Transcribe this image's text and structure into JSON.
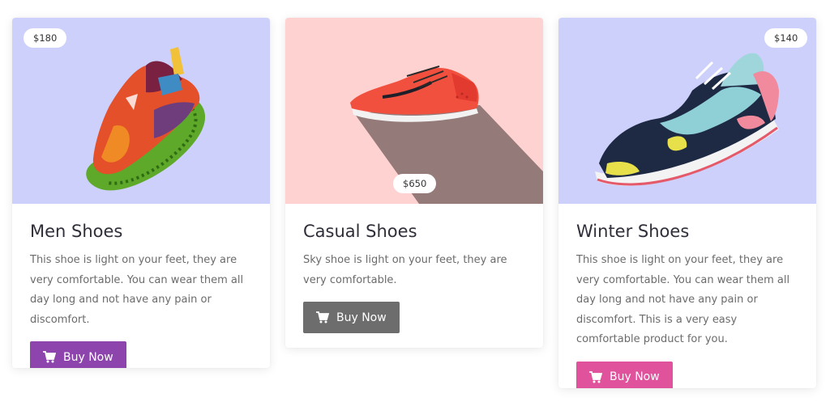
{
  "cards": [
    {
      "price": "$180",
      "title": "Men Shoes",
      "description": "This shoe is light on your feet, they are very comfortable. You can wear them all day long and not have any pain or discomfort.",
      "button_label": "Buy Now",
      "button_icon": "cart-icon",
      "image_bg": "#cdd0fb",
      "button_color": "#8d44ad"
    },
    {
      "price": "$650",
      "title": "Casual Shoes",
      "description": "Sky shoe is light on your feet, they are very comfortable.",
      "button_label": "Buy Now",
      "button_icon": "cart-icon",
      "image_bg": "#fdd2d0",
      "button_color": "#6d6d6d"
    },
    {
      "price": "$140",
      "title": "Winter Shoes",
      "description": "This shoe is light on your feet, they are very comfortable. You can wear them all day long and not have any pain or discomfort. This is a very easy comfortable product for you.",
      "button_label": "Buy Now",
      "button_icon": "cart-icon",
      "image_bg": "#cdd0fb",
      "button_color": "#e0529b"
    }
  ]
}
